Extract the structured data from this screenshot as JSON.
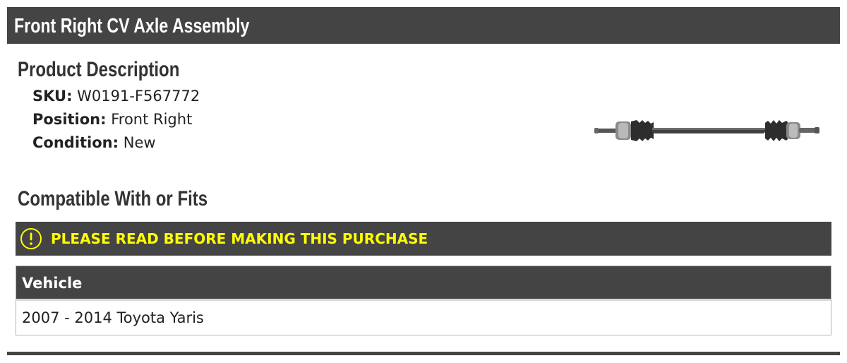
{
  "header": {
    "title": "Front Right CV Axle Assembly"
  },
  "product_description": {
    "heading": "Product Description",
    "specs": [
      {
        "label": "SKU:",
        "value": "W0191-F567772"
      },
      {
        "label": "Position:",
        "value": "Front Right"
      },
      {
        "label": "Condition:",
        "value": "New"
      }
    ],
    "image": "cv-axle-shaft"
  },
  "compatibility": {
    "heading": "Compatible With or Fits",
    "warning": {
      "icon": "exclamation-circle-icon",
      "text": "PLEASE READ BEFORE MAKING THIS PURCHASE",
      "color": "#ffff00"
    },
    "table": {
      "columns": [
        "Vehicle"
      ],
      "rows": [
        [
          "2007 - 2014 Toyota Yaris"
        ]
      ]
    }
  },
  "colors": {
    "bar_background": "#444444",
    "warning_text": "#ffff00"
  }
}
